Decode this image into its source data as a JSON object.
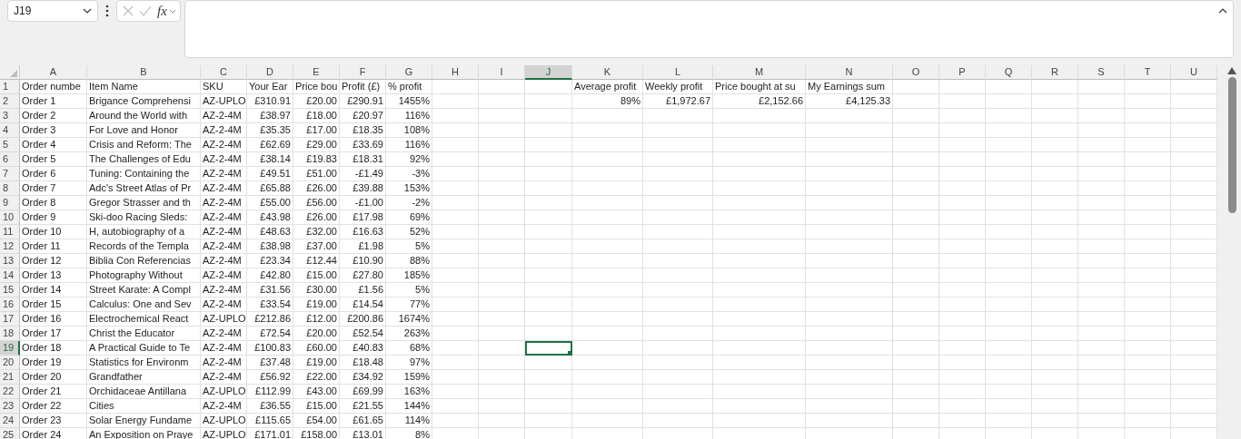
{
  "name_box": {
    "value": "J19"
  },
  "function_button": {
    "label": "fx"
  },
  "columns": [
    {
      "label": "A",
      "selected": false,
      "numeric": false
    },
    {
      "label": "B",
      "selected": false,
      "numeric": false
    },
    {
      "label": "C",
      "selected": false,
      "numeric": false
    },
    {
      "label": "D",
      "selected": false,
      "numeric": true
    },
    {
      "label": "E",
      "selected": false,
      "numeric": true
    },
    {
      "label": "F",
      "selected": false,
      "numeric": true
    },
    {
      "label": "G",
      "selected": false,
      "numeric": true
    },
    {
      "label": "H",
      "selected": false,
      "numeric": false
    },
    {
      "label": "I",
      "selected": false,
      "numeric": false
    },
    {
      "label": "J",
      "selected": true,
      "numeric": false
    },
    {
      "label": "K",
      "selected": false,
      "numeric": true
    },
    {
      "label": "L",
      "selected": false,
      "numeric": true
    },
    {
      "label": "M",
      "selected": false,
      "numeric": true
    },
    {
      "label": "N",
      "selected": false,
      "numeric": true
    },
    {
      "label": "O",
      "selected": false,
      "numeric": false
    },
    {
      "label": "P",
      "selected": false,
      "numeric": false
    },
    {
      "label": "Q",
      "selected": false,
      "numeric": false
    },
    {
      "label": "R",
      "selected": false,
      "numeric": false
    },
    {
      "label": "S",
      "selected": false,
      "numeric": false
    },
    {
      "label": "T",
      "selected": false,
      "numeric": false
    },
    {
      "label": "U",
      "selected": false,
      "numeric": false
    }
  ],
  "rows": [
    {
      "number": "1",
      "selected": false,
      "kind": "header",
      "cells": {
        "A": "Order numbe",
        "B": "Item Name",
        "C": "SKU",
        "D": "Your Ear",
        "E": "Price bou",
        "F": "Profit (£)",
        "G": "% profit",
        "K": "Average profit",
        "L": "Weekly profit",
        "M": "Price bought at su",
        "N": "My Earnings sum"
      }
    },
    {
      "number": "2",
      "selected": false,
      "kind": "data",
      "cells": {
        "A": "Order 1",
        "B": "Brigance Comprehensi",
        "C": "AZ-UPLO",
        "D": "£310.91",
        "E": "£20.00",
        "F": "£290.91",
        "G": "1455%",
        "K": "89%",
        "L": "£1,972.67",
        "M": "£2,152.66",
        "N": "£4,125.33"
      }
    },
    {
      "number": "3",
      "selected": false,
      "kind": "data",
      "cells": {
        "A": "Order 2",
        "B": "Around the World with",
        "C": "AZ-2-4M",
        "D": "£38.97",
        "E": "£18.00",
        "F": "£20.97",
        "G": "116%"
      }
    },
    {
      "number": "4",
      "selected": false,
      "kind": "data",
      "cells": {
        "A": "Order 3",
        "B": "For Love and Honor",
        "C": "AZ-2-4M",
        "D": "£35.35",
        "E": "£17.00",
        "F": "£18.35",
        "G": "108%"
      }
    },
    {
      "number": "5",
      "selected": false,
      "kind": "data",
      "cells": {
        "A": "Order 4",
        "B": "Crisis and Reform: The",
        "C": "AZ-2-4M",
        "D": "£62.69",
        "E": "£29.00",
        "F": "£33.69",
        "G": "116%"
      }
    },
    {
      "number": "6",
      "selected": false,
      "kind": "data",
      "cells": {
        "A": "Order 5",
        "B": "The Challenges of Edu",
        "C": "AZ-2-4M",
        "D": "£38.14",
        "E": "£19.83",
        "F": "£18.31",
        "G": "92%"
      }
    },
    {
      "number": "7",
      "selected": false,
      "kind": "data",
      "cells": {
        "A": "Order 6",
        "B": "Tuning: Containing the",
        "C": "AZ-2-4M",
        "D": "£49.51",
        "E": "£51.00",
        "F": "-£1.49",
        "G": "-3%"
      }
    },
    {
      "number": "8",
      "selected": false,
      "kind": "data",
      "cells": {
        "A": "Order 7",
        "B": "Adc's Street Atlas of Pr",
        "C": "AZ-2-4M",
        "D": "£65.88",
        "E": "£26.00",
        "F": "£39.88",
        "G": "153%"
      }
    },
    {
      "number": "9",
      "selected": false,
      "kind": "data",
      "cells": {
        "A": "Order 8",
        "B": "Gregor Strasser and th",
        "C": "AZ-2-4M",
        "D": "£55.00",
        "E": "£56.00",
        "F": "-£1.00",
        "G": "-2%"
      }
    },
    {
      "number": "10",
      "selected": false,
      "kind": "data",
      "cells": {
        "A": "Order 9",
        "B": "Ski-doo Racing Sleds:",
        "C": "AZ-2-4M",
        "D": "£43.98",
        "E": "£26.00",
        "F": "£17.98",
        "G": "69%"
      }
    },
    {
      "number": "11",
      "selected": false,
      "kind": "data",
      "cells": {
        "A": "Order 10",
        "B": "H, autobiography of a",
        "C": "AZ-2-4M",
        "D": "£48.63",
        "E": "£32.00",
        "F": "£16.63",
        "G": "52%"
      }
    },
    {
      "number": "12",
      "selected": false,
      "kind": "data",
      "cells": {
        "A": "Order 11",
        "B": "Records of the Templa",
        "C": "AZ-2-4M",
        "D": "£38.98",
        "E": "£37.00",
        "F": "£1.98",
        "G": "5%"
      }
    },
    {
      "number": "13",
      "selected": false,
      "kind": "data",
      "cells": {
        "A": "Order 12",
        "B": "Biblia Con Referencias",
        "C": "AZ-2-4M",
        "D": "£23.34",
        "E": "£12.44",
        "F": "£10.90",
        "G": "88%"
      }
    },
    {
      "number": "14",
      "selected": false,
      "kind": "data",
      "cells": {
        "A": "Order 13",
        "B": "Photography Without",
        "C": "AZ-2-4M",
        "D": "£42.80",
        "E": "£15.00",
        "F": "£27.80",
        "G": "185%"
      }
    },
    {
      "number": "15",
      "selected": false,
      "kind": "data",
      "cells": {
        "A": "Order 14",
        "B": "Street Karate: A Compl",
        "C": "AZ-2-4M",
        "D": "£31.56",
        "E": "£30.00",
        "F": "£1.56",
        "G": "5%"
      }
    },
    {
      "number": "16",
      "selected": false,
      "kind": "data",
      "cells": {
        "A": "Order 15",
        "B": "Calculus: One and Sev",
        "C": "AZ-2-4M",
        "D": "£33.54",
        "E": "£19.00",
        "F": "£14.54",
        "G": "77%"
      }
    },
    {
      "number": "17",
      "selected": false,
      "kind": "data",
      "cells": {
        "A": "Order 16",
        "B": "Electrochemical React",
        "C": "AZ-UPLO",
        "D": "£212.86",
        "E": "£12.00",
        "F": "£200.86",
        "G": "1674%"
      }
    },
    {
      "number": "18",
      "selected": false,
      "kind": "data",
      "cells": {
        "A": "Order 17",
        "B": "Christ the Educator",
        "C": "AZ-2-4M",
        "D": "£72.54",
        "E": "£20.00",
        "F": "£52.54",
        "G": "263%"
      }
    },
    {
      "number": "19",
      "selected": true,
      "kind": "data",
      "cells": {
        "A": "Order 18",
        "B": "A Practical Guide to Te",
        "C": "AZ-2-4M",
        "D": "£100.83",
        "E": "£60.00",
        "F": "£40.83",
        "G": "68%"
      }
    },
    {
      "number": "20",
      "selected": false,
      "kind": "data",
      "cells": {
        "A": "Order 19",
        "B": "Statistics for Environm",
        "C": "AZ-2-4M",
        "D": "£37.48",
        "E": "£19.00",
        "F": "£18.48",
        "G": "97%"
      }
    },
    {
      "number": "21",
      "selected": false,
      "kind": "data",
      "cells": {
        "A": "Order 20",
        "B": "Grandfather",
        "C": "AZ-2-4M",
        "D": "£56.92",
        "E": "£22.00",
        "F": "£34.92",
        "G": "159%"
      }
    },
    {
      "number": "22",
      "selected": false,
      "kind": "data",
      "cells": {
        "A": "Order 21",
        "B": "Orchidaceae Antillana",
        "C": "AZ-UPLO",
        "D": "£112.99",
        "E": "£43.00",
        "F": "£69.99",
        "G": "163%"
      }
    },
    {
      "number": "23",
      "selected": false,
      "kind": "data",
      "cells": {
        "A": "Order 22",
        "B": "Cities",
        "C": "AZ-2-4M",
        "D": "£36.55",
        "E": "£15.00",
        "F": "£21.55",
        "G": "144%"
      }
    },
    {
      "number": "24",
      "selected": false,
      "kind": "data",
      "cells": {
        "A": "Order 23",
        "B": "Solar Energy Fundame",
        "C": "AZ-UPLO",
        "D": "£115.65",
        "E": "£54.00",
        "F": "£61.65",
        "G": "114%"
      }
    },
    {
      "number": "25",
      "selected": false,
      "kind": "data",
      "cells": {
        "A": "Order 24",
        "B": "An Exposition on Praye",
        "C": "AZ-UPLO",
        "D": "£171.01",
        "E": "£158.00",
        "F": "£13.01",
        "G": "8%"
      }
    }
  ]
}
